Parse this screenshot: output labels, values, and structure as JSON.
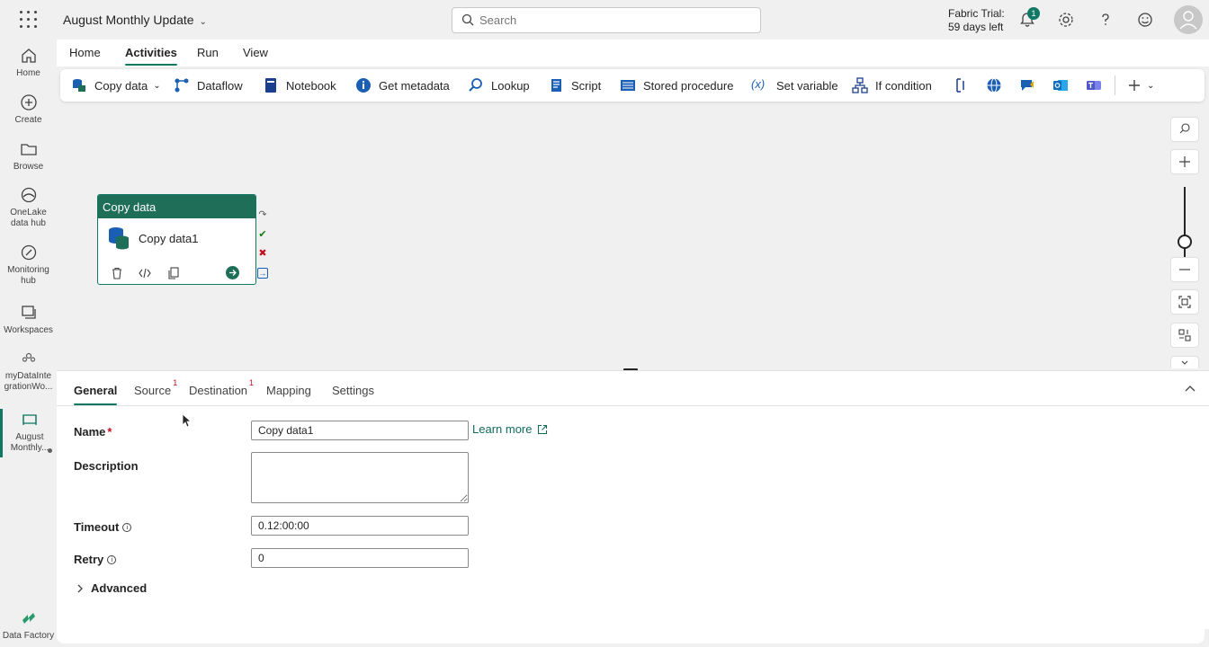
{
  "app": {
    "title": "August Monthly Update",
    "search_placeholder": "Search",
    "trial_line1": "Fabric Trial:",
    "trial_line2": "59 days left",
    "notification_count": "1"
  },
  "rail": [
    {
      "label": "Home"
    },
    {
      "label": "Create"
    },
    {
      "label": "Browse"
    },
    {
      "label": "OneLake data hub"
    },
    {
      "label": "Monitoring hub"
    },
    {
      "label": "Workspaces"
    },
    {
      "label": "myDataIntegrationWo..."
    },
    {
      "label": "August Monthly..."
    },
    {
      "label": "Data Factory"
    }
  ],
  "ribbon": {
    "tabs": [
      "Home",
      "Activities",
      "Run",
      "View"
    ],
    "active_tab": "Activities",
    "tools": {
      "copy_data": "Copy data",
      "dataflow": "Dataflow",
      "notebook": "Notebook",
      "get_metadata": "Get metadata",
      "lookup": "Lookup",
      "script": "Script",
      "stored_procedure": "Stored procedure",
      "set_variable": "Set variable",
      "if_condition": "If condition"
    }
  },
  "canvas": {
    "node": {
      "type": "Copy data",
      "name": "Copy data1"
    }
  },
  "pane": {
    "tabs": {
      "general": "General",
      "source": "Source",
      "source_badge": "1",
      "destination": "Destination",
      "destination_badge": "1",
      "mapping": "Mapping",
      "settings": "Settings"
    },
    "fields": {
      "name_label": "Name",
      "name_required": "*",
      "name_value": "Copy data1",
      "learn_more": "Learn more",
      "description_label": "Description",
      "description_value": "",
      "timeout_label": "Timeout",
      "timeout_value": "0.12:00:00",
      "retry_label": "Retry",
      "retry_value": "0"
    },
    "advanced": "Advanced"
  },
  "colors": {
    "accent": "#117865",
    "node_header": "#1f6e58",
    "error": "#c50f1f"
  }
}
